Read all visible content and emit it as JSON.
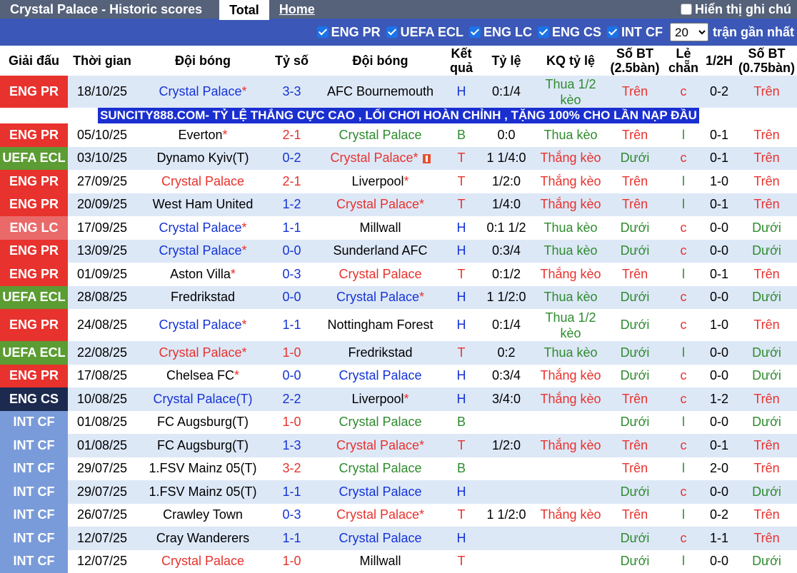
{
  "topbar": {
    "title": "Crystal Palace - Historic scores",
    "tab_total": "Total",
    "tab_home": "Home",
    "toggle_label": "Hiển thị ghi chú"
  },
  "filters": {
    "items": [
      "ENG PR",
      "UEFA ECL",
      "ENG LC",
      "ENG CS",
      "INT CF"
    ],
    "count": "20",
    "recent_label": "trận gần nhất"
  },
  "headers": [
    "Giải đấu",
    "Thời gian",
    "Đội bóng",
    "Tỷ số",
    "Đội bóng",
    "Kết quả",
    "Tỷ lệ",
    "KQ tỷ lệ",
    "Số BT (2.5bàn)",
    "Lẻ chẵn",
    "1/2H",
    "Số BT (0.75bàn)"
  ],
  "colors": {
    "ENG PR": "#e8322d",
    "UEFA ECL": "#5b9c33",
    "ENG LC": "#ea6a6a",
    "ENG CS": "#1c2a4f",
    "INT CF": "#7a9bd9"
  },
  "ad_text": "SUNCITY888.COM- TỶ LỆ THẮNG CỰC CAO , LỐI CHƠI HOÀN CHỈNH , TẶNG 100% CHO LẦN NẠP ĐẦU",
  "rows": [
    {
      "league": "ENG PR",
      "date": "18/10/25",
      "home": "Crystal Palace",
      "home_star": true,
      "home_color": "blue",
      "score": "3-3",
      "score_color": "blue",
      "away": "AFC Bournemouth",
      "away_star": false,
      "away_color": "black",
      "result": "H",
      "result_color": "blue",
      "odds": "0:1/4",
      "odds_result": "Thua 1/2 kèo",
      "or_color": "green",
      "ou": "Trên",
      "ou_color": "red",
      "oe": "c",
      "oe_color": "red",
      "half": "0-2",
      "ou2": "Trên",
      "ou2_color": "red",
      "tall": true,
      "ad_after": true
    },
    {
      "league": "ENG PR",
      "date": "05/10/25",
      "home": "Everton",
      "home_star": true,
      "home_color": "black",
      "score": "2-1",
      "score_color": "red",
      "away": "Crystal Palace",
      "away_star": false,
      "away_color": "green",
      "result": "B",
      "result_color": "green",
      "odds": "0:0",
      "odds_result": "Thua kèo",
      "or_color": "green",
      "ou": "Trên",
      "ou_color": "red",
      "oe": "l",
      "oe_color": "green",
      "half": "0-1",
      "ou2": "Trên",
      "ou2_color": "red"
    },
    {
      "league": "UEFA ECL",
      "date": "03/10/25",
      "home": "Dynamo Kyiv(T)",
      "home_star": false,
      "home_color": "black",
      "score": "0-2",
      "score_color": "blue",
      "away": "Crystal Palace",
      "away_star": true,
      "away_color": "red",
      "away_flag": true,
      "result": "T",
      "result_color": "red",
      "odds": "1 1/4:0",
      "odds_result": "Thắng kèo",
      "or_color": "red",
      "ou": "Dưới",
      "ou_color": "green",
      "oe": "c",
      "oe_color": "red",
      "half": "0-1",
      "ou2": "Trên",
      "ou2_color": "red"
    },
    {
      "league": "ENG PR",
      "date": "27/09/25",
      "home": "Crystal Palace",
      "home_star": false,
      "home_color": "red",
      "score": "2-1",
      "score_color": "red",
      "away": "Liverpool",
      "away_star": true,
      "away_color": "black",
      "result": "T",
      "result_color": "red",
      "odds": "1/2:0",
      "odds_result": "Thắng kèo",
      "or_color": "red",
      "ou": "Trên",
      "ou_color": "red",
      "oe": "l",
      "oe_color": "green",
      "half": "1-0",
      "ou2": "Trên",
      "ou2_color": "red"
    },
    {
      "league": "ENG PR",
      "date": "20/09/25",
      "home": "West Ham United",
      "home_star": false,
      "home_color": "black",
      "score": "1-2",
      "score_color": "blue",
      "away": "Crystal Palace",
      "away_star": true,
      "away_color": "red",
      "result": "T",
      "result_color": "red",
      "odds": "1/4:0",
      "odds_result": "Thắng kèo",
      "or_color": "red",
      "ou": "Trên",
      "ou_color": "red",
      "oe": "l",
      "oe_color": "green",
      "half": "0-1",
      "ou2": "Trên",
      "ou2_color": "red"
    },
    {
      "league": "ENG LC",
      "date": "17/09/25",
      "home": "Crystal Palace",
      "home_star": true,
      "home_color": "blue",
      "score": "1-1",
      "score_color": "blue",
      "away": "Millwall",
      "away_star": false,
      "away_color": "black",
      "result": "H",
      "result_color": "blue",
      "odds": "0:1 1/2",
      "odds_result": "Thua kèo",
      "or_color": "green",
      "ou": "Dưới",
      "ou_color": "green",
      "oe": "c",
      "oe_color": "red",
      "half": "0-0",
      "ou2": "Dưới",
      "ou2_color": "green"
    },
    {
      "league": "ENG PR",
      "date": "13/09/25",
      "home": "Crystal Palace",
      "home_star": true,
      "home_color": "blue",
      "score": "0-0",
      "score_color": "blue",
      "away": "Sunderland AFC",
      "away_star": false,
      "away_color": "black",
      "result": "H",
      "result_color": "blue",
      "odds": "0:3/4",
      "odds_result": "Thua kèo",
      "or_color": "green",
      "ou": "Dưới",
      "ou_color": "green",
      "oe": "c",
      "oe_color": "red",
      "half": "0-0",
      "ou2": "Dưới",
      "ou2_color": "green"
    },
    {
      "league": "ENG PR",
      "date": "01/09/25",
      "home": "Aston Villa",
      "home_star": true,
      "home_color": "black",
      "score": "0-3",
      "score_color": "blue",
      "away": "Crystal Palace",
      "away_star": false,
      "away_color": "red",
      "result": "T",
      "result_color": "red",
      "odds": "0:1/2",
      "odds_result": "Thắng kèo",
      "or_color": "red",
      "ou": "Trên",
      "ou_color": "red",
      "oe": "l",
      "oe_color": "green",
      "half": "0-1",
      "ou2": "Trên",
      "ou2_color": "red"
    },
    {
      "league": "UEFA ECL",
      "date": "28/08/25",
      "home": "Fredrikstad",
      "home_star": false,
      "home_color": "black",
      "score": "0-0",
      "score_color": "blue",
      "away": "Crystal Palace",
      "away_star": true,
      "away_color": "blue",
      "result": "H",
      "result_color": "blue",
      "odds": "1 1/2:0",
      "odds_result": "Thua kèo",
      "or_color": "green",
      "ou": "Dưới",
      "ou_color": "green",
      "oe": "c",
      "oe_color": "red",
      "half": "0-0",
      "ou2": "Dưới",
      "ou2_color": "green"
    },
    {
      "league": "ENG PR",
      "date": "24/08/25",
      "home": "Crystal Palace",
      "home_star": true,
      "home_color": "blue",
      "score": "1-1",
      "score_color": "blue",
      "away": "Nottingham Forest",
      "away_star": false,
      "away_color": "black",
      "result": "H",
      "result_color": "blue",
      "odds": "0:1/4",
      "odds_result": "Thua 1/2 kèo",
      "or_color": "green",
      "ou": "Dưới",
      "ou_color": "green",
      "oe": "c",
      "oe_color": "red",
      "half": "1-0",
      "ou2": "Trên",
      "ou2_color": "red",
      "tall": true
    },
    {
      "league": "UEFA ECL",
      "date": "22/08/25",
      "home": "Crystal Palace",
      "home_star": true,
      "home_color": "red",
      "score": "1-0",
      "score_color": "red",
      "away": "Fredrikstad",
      "away_star": false,
      "away_color": "black",
      "result": "T",
      "result_color": "red",
      "odds": "0:2",
      "odds_result": "Thua kèo",
      "or_color": "green",
      "ou": "Dưới",
      "ou_color": "green",
      "oe": "l",
      "oe_color": "green",
      "half": "0-0",
      "ou2": "Dưới",
      "ou2_color": "green"
    },
    {
      "league": "ENG PR",
      "date": "17/08/25",
      "home": "Chelsea FC",
      "home_star": true,
      "home_color": "black",
      "score": "0-0",
      "score_color": "blue",
      "away": "Crystal Palace",
      "away_star": false,
      "away_color": "blue",
      "result": "H",
      "result_color": "blue",
      "odds": "0:3/4",
      "odds_result": "Thắng kèo",
      "or_color": "red",
      "ou": "Dưới",
      "ou_color": "green",
      "oe": "c",
      "oe_color": "red",
      "half": "0-0",
      "ou2": "Dưới",
      "ou2_color": "green"
    },
    {
      "league": "ENG CS",
      "date": "10/08/25",
      "home": "Crystal Palace(T)",
      "home_star": false,
      "home_color": "blue",
      "score": "2-2",
      "score_color": "blue",
      "away": "Liverpool",
      "away_star": true,
      "away_color": "black",
      "result": "H",
      "result_color": "blue",
      "odds": "3/4:0",
      "odds_result": "Thắng kèo",
      "or_color": "red",
      "ou": "Trên",
      "ou_color": "red",
      "oe": "c",
      "oe_color": "red",
      "half": "1-2",
      "ou2": "Trên",
      "ou2_color": "red"
    },
    {
      "league": "INT CF",
      "date": "01/08/25",
      "home": "FC Augsburg(T)",
      "home_star": false,
      "home_color": "black",
      "score": "1-0",
      "score_color": "red",
      "away": "Crystal Palace",
      "away_star": false,
      "away_color": "green",
      "result": "B",
      "result_color": "green",
      "odds": "",
      "odds_result": "",
      "or_color": "green",
      "ou": "Dưới",
      "ou_color": "green",
      "oe": "l",
      "oe_color": "green",
      "half": "0-0",
      "ou2": "Dưới",
      "ou2_color": "green"
    },
    {
      "league": "INT CF",
      "date": "01/08/25",
      "home": "FC Augsburg(T)",
      "home_star": false,
      "home_color": "black",
      "score": "1-3",
      "score_color": "blue",
      "away": "Crystal Palace",
      "away_star": true,
      "away_color": "red",
      "result": "T",
      "result_color": "red",
      "odds": "1/2:0",
      "odds_result": "Thắng kèo",
      "or_color": "red",
      "ou": "Trên",
      "ou_color": "red",
      "oe": "c",
      "oe_color": "red",
      "half": "0-1",
      "ou2": "Trên",
      "ou2_color": "red"
    },
    {
      "league": "INT CF",
      "date": "29/07/25",
      "home": "1.FSV Mainz 05(T)",
      "home_star": false,
      "home_color": "black",
      "score": "3-2",
      "score_color": "red",
      "away": "Crystal Palace",
      "away_star": false,
      "away_color": "green",
      "result": "B",
      "result_color": "green",
      "odds": "",
      "odds_result": "",
      "or_color": "green",
      "ou": "Trên",
      "ou_color": "red",
      "oe": "l",
      "oe_color": "green",
      "half": "2-0",
      "ou2": "Trên",
      "ou2_color": "red"
    },
    {
      "league": "INT CF",
      "date": "29/07/25",
      "home": "1.FSV Mainz 05(T)",
      "home_star": false,
      "home_color": "black",
      "score": "1-1",
      "score_color": "blue",
      "away": "Crystal Palace",
      "away_star": false,
      "away_color": "blue",
      "result": "H",
      "result_color": "blue",
      "odds": "",
      "odds_result": "",
      "or_color": "green",
      "ou": "Dưới",
      "ou_color": "green",
      "oe": "c",
      "oe_color": "red",
      "half": "0-0",
      "ou2": "Dưới",
      "ou2_color": "green"
    },
    {
      "league": "INT CF",
      "date": "26/07/25",
      "home": "Crawley Town",
      "home_star": false,
      "home_color": "black",
      "score": "0-3",
      "score_color": "blue",
      "away": "Crystal Palace",
      "away_star": true,
      "away_color": "red",
      "result": "T",
      "result_color": "red",
      "odds": "1 1/2:0",
      "odds_result": "Thắng kèo",
      "or_color": "red",
      "ou": "Trên",
      "ou_color": "red",
      "oe": "l",
      "oe_color": "green",
      "half": "0-2",
      "ou2": "Trên",
      "ou2_color": "red"
    },
    {
      "league": "INT CF",
      "date": "12/07/25",
      "home": "Cray Wanderers",
      "home_star": false,
      "home_color": "black",
      "score": "1-1",
      "score_color": "blue",
      "away": "Crystal Palace",
      "away_star": false,
      "away_color": "blue",
      "result": "H",
      "result_color": "blue",
      "odds": "",
      "odds_result": "",
      "or_color": "green",
      "ou": "Dưới",
      "ou_color": "green",
      "oe": "c",
      "oe_color": "red",
      "half": "1-1",
      "ou2": "Trên",
      "ou2_color": "red"
    },
    {
      "league": "INT CF",
      "date": "12/07/25",
      "home": "Crystal Palace",
      "home_star": false,
      "home_color": "red",
      "score": "1-0",
      "score_color": "red",
      "away": "Millwall",
      "away_star": false,
      "away_color": "black",
      "result": "T",
      "result_color": "red",
      "odds": "",
      "odds_result": "",
      "or_color": "green",
      "ou": "Dưới",
      "ou_color": "green",
      "oe": "l",
      "oe_color": "green",
      "half": "0-0",
      "ou2": "Dưới",
      "ou2_color": "green"
    }
  ]
}
